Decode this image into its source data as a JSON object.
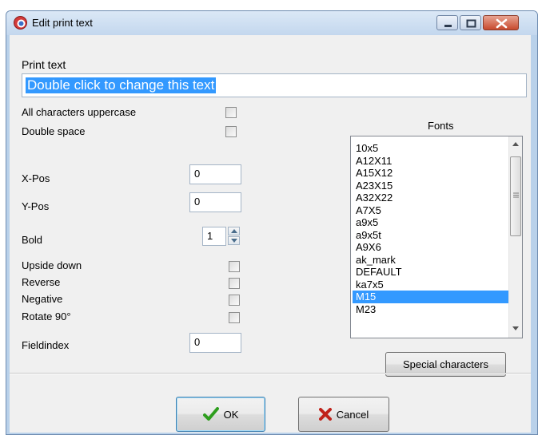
{
  "window": {
    "title": "Edit print text"
  },
  "print_text": {
    "label": "Print text",
    "value": "Double click to change this text"
  },
  "options": {
    "uppercase_label": "All characters uppercase",
    "double_space_label": "Double space",
    "upside_down_label": "Upside down",
    "reverse_label": "Reverse",
    "negative_label": "Negative",
    "rotate_label": "Rotate 90°"
  },
  "fields": {
    "xpos_label": "X-Pos",
    "xpos_value": "0",
    "ypos_label": "Y-Pos",
    "ypos_value": "0",
    "bold_label": "Bold",
    "bold_value": "1",
    "fieldindex_label": "Fieldindex",
    "fieldindex_value": "0"
  },
  "fonts": {
    "label": "Fonts",
    "items": [
      "10x5",
      "A12X11",
      "A15X12",
      "A23X15",
      "A32X22",
      "A7X5",
      "a9x5",
      "a9x5t",
      "A9X6",
      "ak_mark",
      "DEFAULT",
      "ka7x5",
      "M15",
      "M23"
    ],
    "selected": "M15",
    "special_button": "Special characters"
  },
  "buttons": {
    "ok": "OK",
    "cancel": "Cancel"
  },
  "colors": {
    "selection": "#3399ff",
    "ok_check": "#2e9e1e",
    "cancel_x": "#c0221a"
  }
}
